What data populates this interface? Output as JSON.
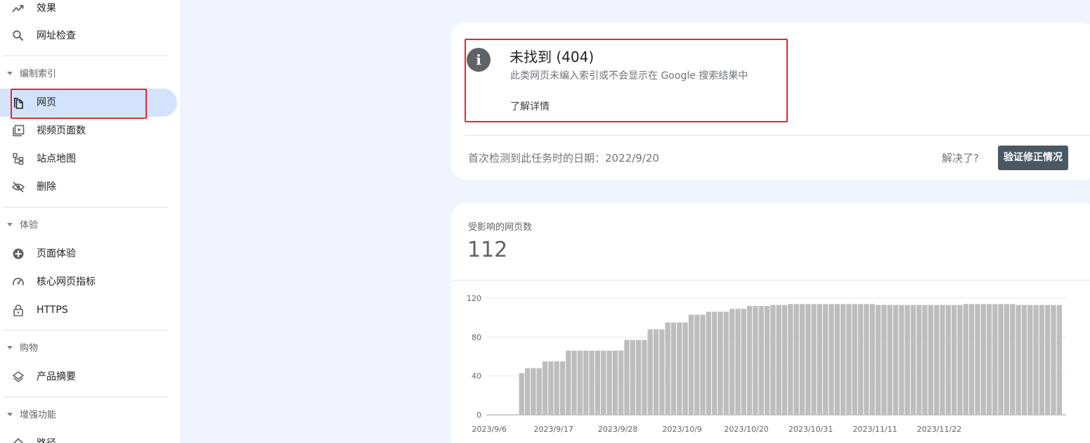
{
  "sidebar": {
    "top_items": [
      {
        "label": "效果",
        "icon": "trending-up-icon"
      },
      {
        "label": "网址检查",
        "icon": "search-icon"
      }
    ],
    "sections": [
      {
        "label": "编制索引",
        "items": [
          {
            "label": "网页",
            "icon": "page-icon",
            "active": true
          },
          {
            "label": "视频页面数",
            "icon": "video-page-icon"
          },
          {
            "label": "站点地图",
            "icon": "sitemap-icon"
          },
          {
            "label": "删除",
            "icon": "eye-off-icon"
          }
        ]
      },
      {
        "label": "体验",
        "items": [
          {
            "label": "页面体验",
            "icon": "plus-circle-icon"
          },
          {
            "label": "核心网页指标",
            "icon": "gauge-icon"
          },
          {
            "label": "HTTPS",
            "icon": "lock-icon"
          }
        ]
      },
      {
        "label": "购物",
        "items": [
          {
            "label": "产品摘要",
            "icon": "layers-icon"
          }
        ]
      },
      {
        "label": "增强功能",
        "items": [
          {
            "label": "路径",
            "icon": "diamond-icon"
          }
        ]
      }
    ]
  },
  "issue": {
    "title": "未找到 (404)",
    "description": "此类网页未编入索引或不会显示在 Google 搜索结果中",
    "learn_more": "了解详情",
    "first_detected": "首次检测到此任务时的日期：2022/9/20",
    "resolved_question": "解决了?",
    "validate_button": "验证修正情况"
  },
  "affected": {
    "label": "受影响的网页数",
    "count": "112"
  },
  "colors": {
    "accent_blue": "#d3e3fd",
    "bar_gray": "#bdbdbd",
    "button_dark": "#4a5863",
    "highlight_red": "#e8262a"
  },
  "chart_data": {
    "type": "bar",
    "ylim": [
      0,
      120
    ],
    "yticks": [
      0,
      40,
      80,
      120
    ],
    "xtick_labels": [
      "2023/9/6",
      "2023/9/17",
      "2023/9/28",
      "2023/10/9",
      "2023/10/20",
      "2023/10/31",
      "2023/11/11",
      "2023/11/22"
    ],
    "values": [
      0,
      0,
      0,
      0,
      0,
      43,
      48,
      48,
      48,
      55,
      55,
      55,
      55,
      66,
      66,
      66,
      66,
      66,
      66,
      66,
      66,
      66,
      66,
      77,
      77,
      77,
      77,
      88,
      88,
      88,
      95,
      95,
      95,
      95,
      103,
      103,
      103,
      106,
      106,
      106,
      106,
      109,
      109,
      109,
      112,
      112,
      112,
      112,
      113,
      113,
      113,
      114,
      114,
      114,
      114,
      114,
      114,
      114,
      114,
      114,
      114,
      114,
      114,
      114,
      114,
      114,
      113,
      113,
      113,
      113,
      113,
      113,
      113,
      113,
      113,
      113,
      113,
      113,
      113,
      113,
      113,
      114,
      114,
      114,
      114,
      114,
      114,
      114,
      114,
      114,
      113,
      113,
      113,
      113,
      113,
      113,
      113,
      113
    ]
  }
}
